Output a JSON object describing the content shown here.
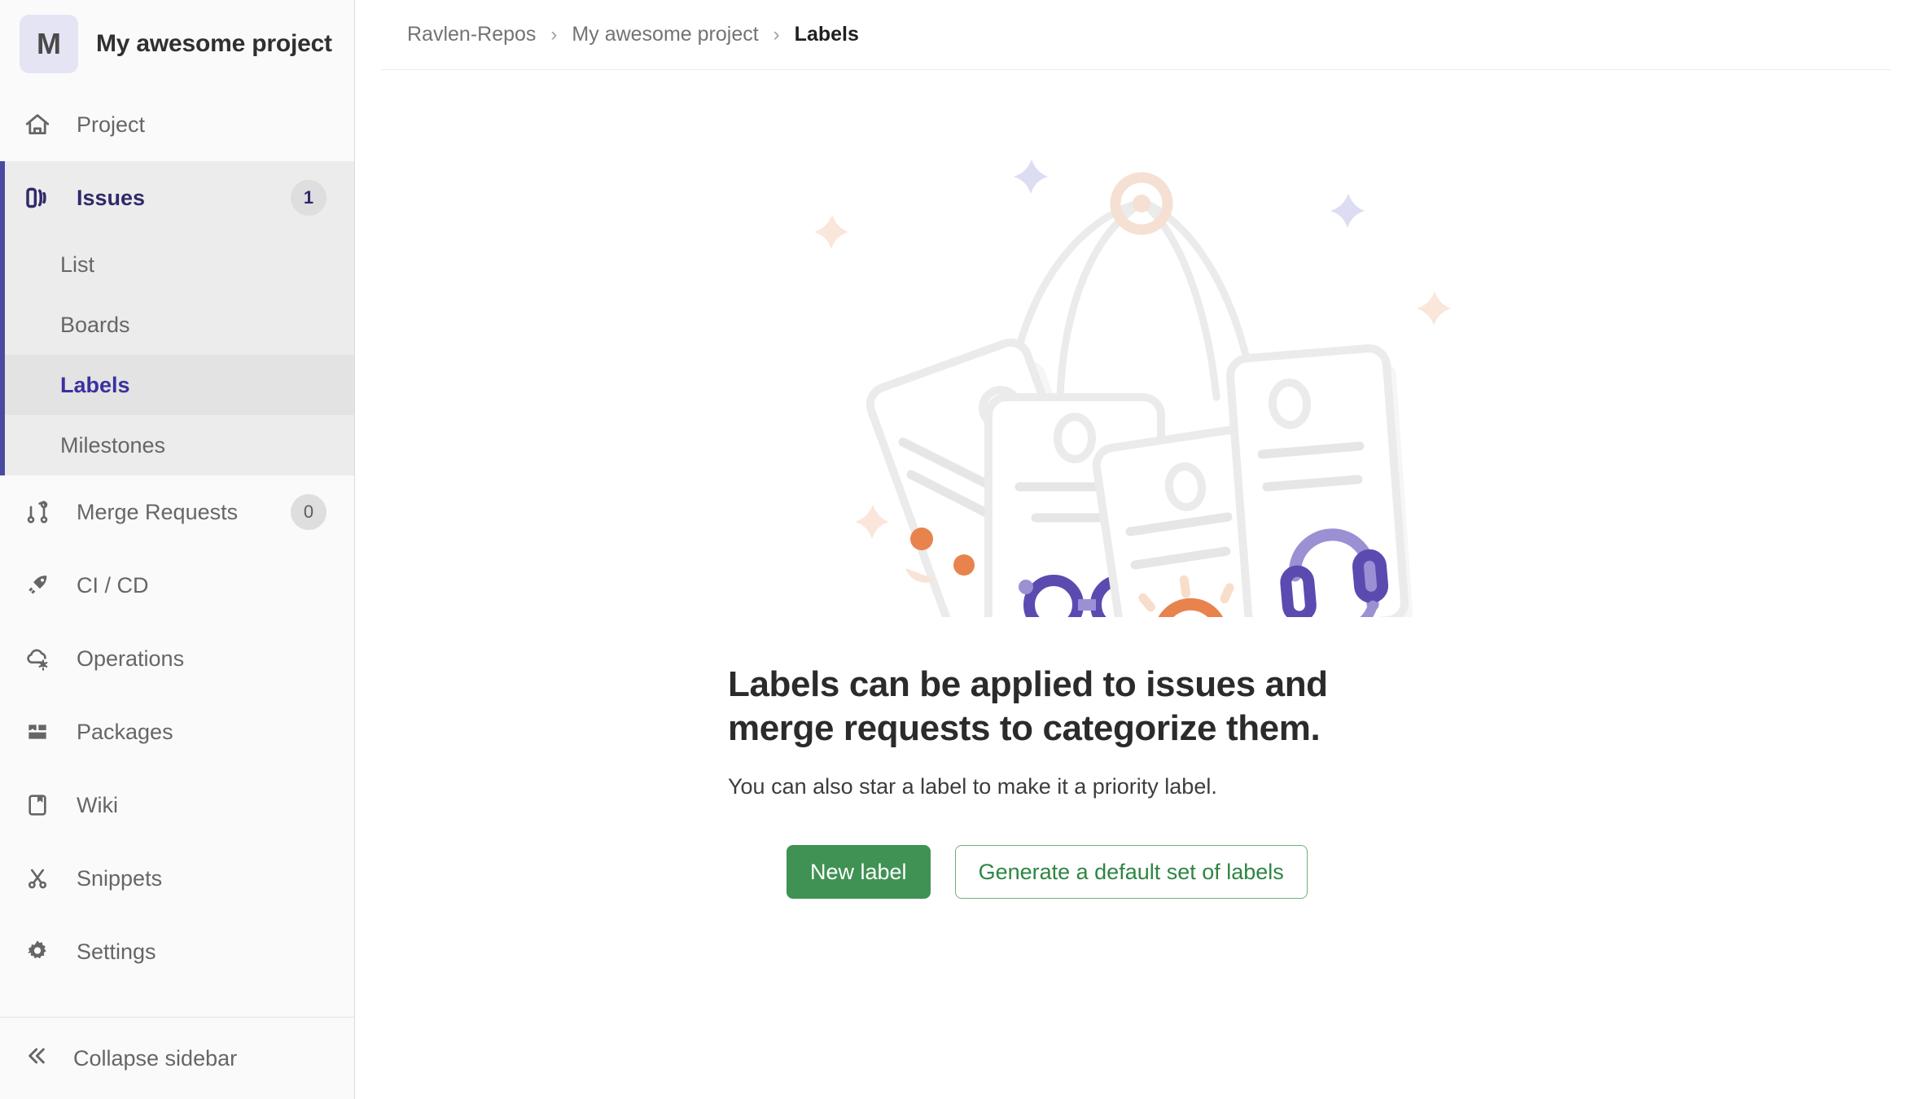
{
  "sidebar": {
    "project": {
      "initial": "M",
      "name": "My awesome project",
      "avatar_bg": "#e4e4f4"
    },
    "items": [
      {
        "label": "Project",
        "icon": "home-icon",
        "badge": null,
        "active": false
      },
      {
        "label": "Issues",
        "icon": "issues-icon",
        "badge": "1",
        "active": true
      },
      {
        "label": "Merge Requests",
        "icon": "merge-request-icon",
        "badge": "0",
        "active": false
      },
      {
        "label": "CI / CD",
        "icon": "rocket-icon",
        "badge": null,
        "active": false
      },
      {
        "label": "Operations",
        "icon": "cloud-gear-icon",
        "badge": null,
        "active": false
      },
      {
        "label": "Packages",
        "icon": "package-icon",
        "badge": null,
        "active": false
      },
      {
        "label": "Wiki",
        "icon": "book-icon",
        "badge": null,
        "active": false
      },
      {
        "label": "Snippets",
        "icon": "snippet-icon",
        "badge": null,
        "active": false
      },
      {
        "label": "Settings",
        "icon": "gear-icon",
        "badge": null,
        "active": false
      }
    ],
    "subnav": [
      {
        "label": "List",
        "current": false
      },
      {
        "label": "Boards",
        "current": false
      },
      {
        "label": "Labels",
        "current": true
      },
      {
        "label": "Milestones",
        "current": false
      }
    ],
    "collapse": {
      "label": "Collapse sidebar",
      "icon": "chevrons-left-icon"
    },
    "accent_color": "#4a4a9e"
  },
  "breadcrumb": {
    "items": [
      "Ravlen-Repos",
      "My awesome project",
      "Labels"
    ],
    "separator": "›"
  },
  "empty_state": {
    "title": "Labels can be applied to issues and merge requests to categorize them.",
    "subtitle": "You can also star a label to make it a priority label.",
    "primary_button": "New label",
    "secondary_button": "Generate a default set of labels",
    "primary_color": "#3f9253",
    "secondary_color": "#2e8543",
    "illustration": {
      "name": "hanging-labels-illustration",
      "tag_stroke_color": "#ebebeb",
      "icons": [
        {
          "name": "dots-face-icon",
          "color": "#e8834e"
        },
        {
          "name": "glasses-icon",
          "color": "#5b4bb0"
        },
        {
          "name": "siren-icon",
          "color": "#e8834e"
        },
        {
          "name": "headset-icon",
          "color": "#5b4bb0"
        }
      ],
      "ring_color": "#f5e0d3",
      "sparkle_colors": [
        "#dcdcf2",
        "#fae6da"
      ]
    }
  }
}
